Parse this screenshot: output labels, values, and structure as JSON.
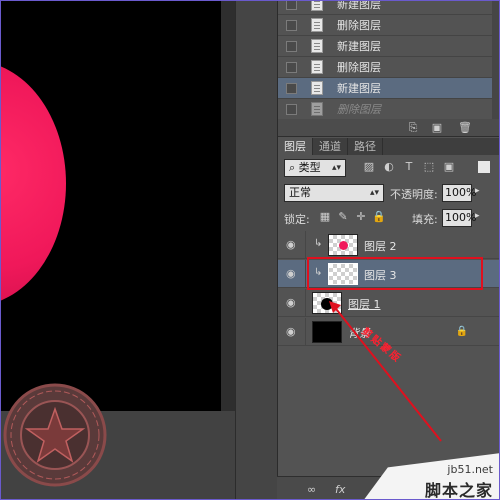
{
  "history": {
    "items": [
      {
        "label": "新建图层",
        "state": "partial"
      },
      {
        "label": "删除图层",
        "state": "normal"
      },
      {
        "label": "新建图层",
        "state": "normal"
      },
      {
        "label": "删除图层",
        "state": "normal"
      },
      {
        "label": "新建图层",
        "state": "selected"
      },
      {
        "label": "删除图层",
        "state": "dim"
      }
    ]
  },
  "tabs": [
    "图层",
    "通道",
    "路径"
  ],
  "filter": {
    "kind_label": "类型"
  },
  "blend": {
    "mode": "正常",
    "opacity_label": "不透明度:",
    "opacity_value": "100%"
  },
  "lock": {
    "label": "锁定:",
    "fill_label": "填充:",
    "fill_value": "100%"
  },
  "layers": [
    {
      "name": "图层 2",
      "thumb": "pink-dot",
      "clip": true,
      "selected": false
    },
    {
      "name": "图层 3",
      "thumb": "empty",
      "clip": true,
      "selected": true
    },
    {
      "name": "图层 1",
      "thumb": "black-dot",
      "clip": false,
      "selected": false
    },
    {
      "name": "背景",
      "thumb": "black",
      "clip": false,
      "selected": false
    }
  ],
  "annotation": {
    "text": "剪贴蒙版"
  },
  "bottom": {
    "fx_label": "fx"
  },
  "watermark": {
    "site": "jb51.net",
    "name": "脚本之家"
  },
  "colors": {
    "accent": "#e0101e",
    "selected": "#5b6b80",
    "canvas_circle": "#f0185a"
  }
}
